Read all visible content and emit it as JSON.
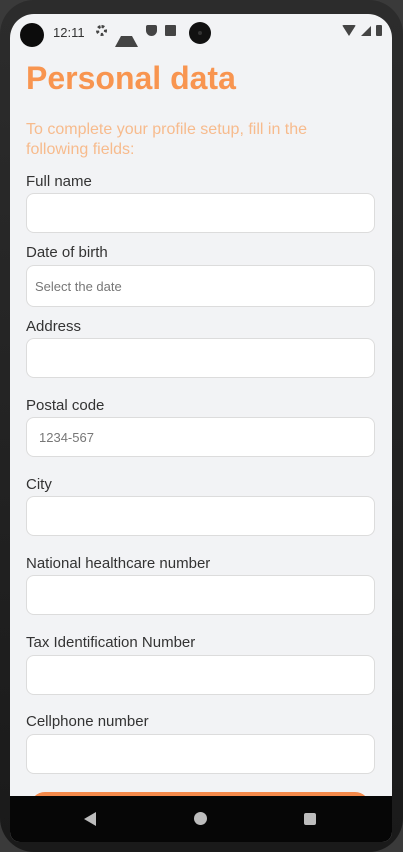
{
  "status": {
    "time": "12:11"
  },
  "header": {
    "title": "Personal data",
    "subtitle": "To complete your profile setup, fill in the following fields:"
  },
  "form": {
    "full_name": {
      "label": "Full name",
      "value": "",
      "placeholder": ""
    },
    "dob": {
      "label": "Date of birth",
      "value": "",
      "placeholder": "Select the date"
    },
    "address": {
      "label": "Address",
      "value": "",
      "placeholder": ""
    },
    "postal": {
      "label": "Postal code",
      "value": "",
      "placeholder": "1234-567"
    },
    "city": {
      "label": "City",
      "value": "",
      "placeholder": ""
    },
    "health": {
      "label": "National healthcare number",
      "value": "",
      "placeholder": ""
    },
    "tax": {
      "label": "Tax Identification Number",
      "value": "",
      "placeholder": ""
    },
    "phone": {
      "label": "Cellphone number",
      "value": "",
      "placeholder": ""
    }
  },
  "colors": {
    "accent": "#f89550",
    "subtitle": "#f7bb8d",
    "background": "#f2f3f5"
  }
}
